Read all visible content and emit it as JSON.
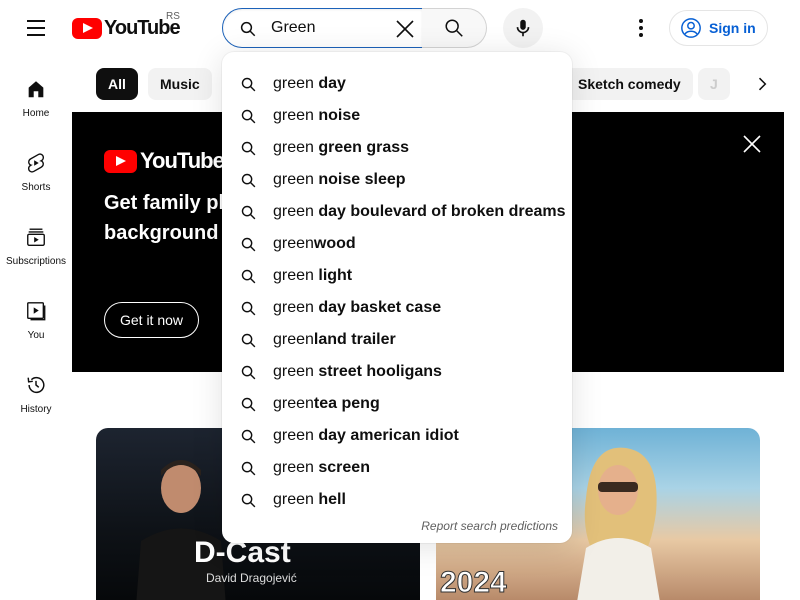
{
  "header": {
    "logo_text": "YouTube",
    "country_code": "RS",
    "search_value": "Green",
    "signin_label": "Sign in"
  },
  "sidebar": {
    "items": [
      {
        "label": "Home",
        "icon": "home-icon"
      },
      {
        "label": "Shorts",
        "icon": "shorts-icon"
      },
      {
        "label": "Subscriptions",
        "icon": "subscriptions-icon"
      },
      {
        "label": "You",
        "icon": "you-icon"
      },
      {
        "label": "History",
        "icon": "history-icon"
      }
    ]
  },
  "chips": {
    "items": [
      "All",
      "Music",
      "Sketch comedy",
      "J"
    ],
    "active": "All"
  },
  "banner": {
    "logo_text": "YouTube M",
    "headline_line1": "Get family pl",
    "headline_line2": "background",
    "cta_label": "Get it now"
  },
  "videos": {
    "left_title_text": "D-Cast",
    "left_subtitle_text": "David Dragojević",
    "right_overlay_text": "2024"
  },
  "suggestions": {
    "typed": "green",
    "items": [
      {
        "typed": "green",
        "rest": " day"
      },
      {
        "typed": "green",
        "rest": " noise"
      },
      {
        "typed": "green",
        "rest": " green grass"
      },
      {
        "typed": "green",
        "rest": " noise sleep"
      },
      {
        "typed": "green",
        "rest": " day boulevard of broken dreams"
      },
      {
        "typed": "green",
        "rest": "wood"
      },
      {
        "typed": "green",
        "rest": " light"
      },
      {
        "typed": "green",
        "rest": " day basket case"
      },
      {
        "typed": "green",
        "rest": "land trailer"
      },
      {
        "typed": "green",
        "rest": " street hooligans"
      },
      {
        "typed": "green",
        "rest": "tea peng"
      },
      {
        "typed": "green",
        "rest": " day american idiot"
      },
      {
        "typed": "green",
        "rest": " screen"
      },
      {
        "typed": "green",
        "rest": " hell"
      }
    ],
    "report_label": "Report search predictions"
  },
  "colors": {
    "brand_red": "#ff0000",
    "link_blue": "#065fd4",
    "focus_blue": "#1c62b9"
  }
}
